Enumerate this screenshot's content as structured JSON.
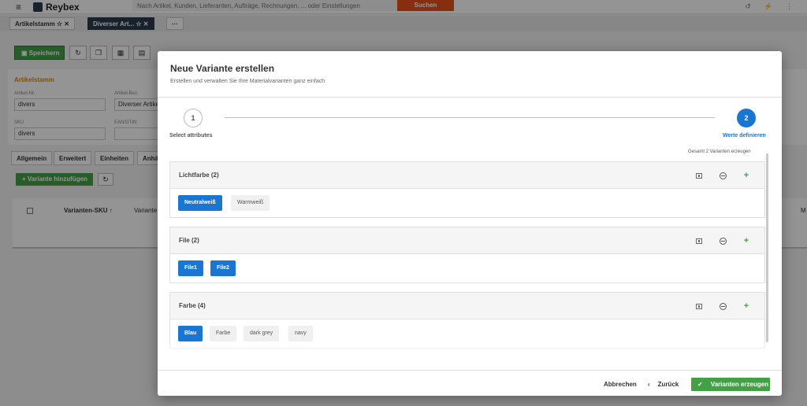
{
  "topbar": {
    "brand": "Reybex",
    "search_placeholder": "Nach Artikel, Kunden, Lieferanten, Aufträge, Rechnungen, ... oder Einstellungen",
    "search_button": "Suchen"
  },
  "tabs": [
    {
      "label": "Artikelstamm ☆ ✕"
    },
    {
      "label": "Diverser Art... ☆ ✕"
    },
    {
      "label": "···"
    }
  ],
  "toolbar": {
    "save_label": "Speichern"
  },
  "form": {
    "section_title": "Artikelstamm",
    "fields": [
      {
        "label": "Artikel-Nr.",
        "value": "divers"
      },
      {
        "label": "Artikel-Bez.",
        "value": "Diverser Artike"
      },
      {
        "label": "SKU",
        "value": "divers"
      },
      {
        "label": "EAN/GTIN",
        "value": ""
      }
    ]
  },
  "subtabs": [
    "Allgemein",
    "Erweitert",
    "Einheiten",
    "Anhä"
  ],
  "variants": {
    "add_button": "Variante hinzufügen",
    "columns": [
      "Varianten-SKU ↑",
      "Variante"
    ],
    "right_col": "M"
  },
  "modal": {
    "title": "Neue Variante erstellen",
    "subtitle": "Erstellen und verwalten Sie Ihre Materialvarianten ganz einfach",
    "steps": [
      {
        "number": "1",
        "label": "Select attributes"
      },
      {
        "number": "2",
        "label": "Werte definieren"
      }
    ],
    "summary": "Gesamt 2 Varianten erzeugen",
    "attributes": [
      {
        "name": "Lichtfarbe (2)",
        "values": [
          {
            "label": "Neutralweiß",
            "selected": true
          },
          {
            "label": "Warmweiß",
            "selected": false
          }
        ]
      },
      {
        "name": "File (2)",
        "values": [
          {
            "label": "File1",
            "selected": true
          },
          {
            "label": "File2",
            "selected": true
          }
        ]
      },
      {
        "name": "Farbe (4)",
        "values": [
          {
            "label": "Blau",
            "selected": true
          },
          {
            "label": "Farbe",
            "selected": false
          },
          {
            "label": "dark grey",
            "selected": false
          },
          {
            "label": "navy",
            "selected": false
          }
        ]
      }
    ],
    "footer": {
      "cancel": "Abbrechen",
      "back": "Zurück",
      "create": "Varianten erzeugen"
    }
  },
  "colors": {
    "primary": "#1976d2",
    "success": "#43a047",
    "search": "#e8501e",
    "accent": "#e08a00"
  }
}
